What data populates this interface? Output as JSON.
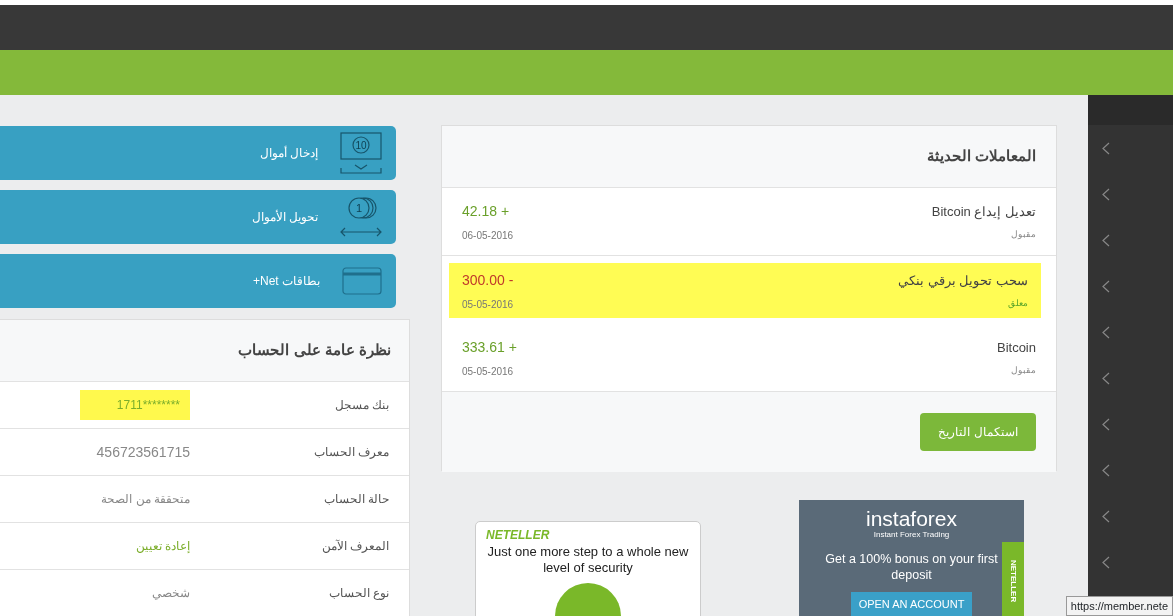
{
  "actions": [
    {
      "label": "إدخال أموال",
      "icon_text": "10"
    },
    {
      "label": "تحويل الأموال",
      "icon_text": "1"
    },
    {
      "label": "بطاقات Net+"
    }
  ],
  "account_overview": {
    "title": "نظرة عامة على الحساب",
    "rows": [
      {
        "label": "بنك مسجل",
        "value": "1711********",
        "kind": "highlighted"
      },
      {
        "label": "معرف الحساب",
        "value": "456723561715",
        "kind": "number"
      },
      {
        "label": "حالة الحساب",
        "value": "متحققة من الصحة",
        "kind": "plain"
      },
      {
        "label": "المعرف الآمن",
        "value": "إعادة تعيين",
        "kind": "link"
      },
      {
        "label": "نوع الحساب",
        "value": "شخصي",
        "kind": "plain"
      }
    ]
  },
  "recent_transactions": {
    "title": "المعاملات الحديثة",
    "items": [
      {
        "title": "تعديل إيداع Bitcoin",
        "status": "مقبول",
        "pending": false,
        "amount": "42.18 +",
        "kind": "credit",
        "date": "06-05-2016",
        "highlighted": false
      },
      {
        "title": "سحب تحويل برقي بنكي",
        "status": "معلق",
        "pending": true,
        "amount": "300.00 -",
        "kind": "debit",
        "date": "05-05-2016",
        "highlighted": true
      },
      {
        "title": "Bitcoin",
        "status": "مقبول",
        "pending": false,
        "amount": "333.61 +",
        "kind": "credit",
        "date": "05-05-2016",
        "highlighted": false
      }
    ],
    "button": "استكمال التاريخ"
  },
  "ads": {
    "neteller": {
      "logo": "NETELLER",
      "text": "Just one more step to a whole new level of security"
    },
    "instaforex": {
      "logo": "instaforex",
      "tagline": "Instant Forex Trading",
      "text": "Get a 100% bonus on your first deposit",
      "button": "OPEN AN ACCOUNT",
      "side_tag": "NETELLER"
    }
  },
  "status_url": "https://member.nete"
}
